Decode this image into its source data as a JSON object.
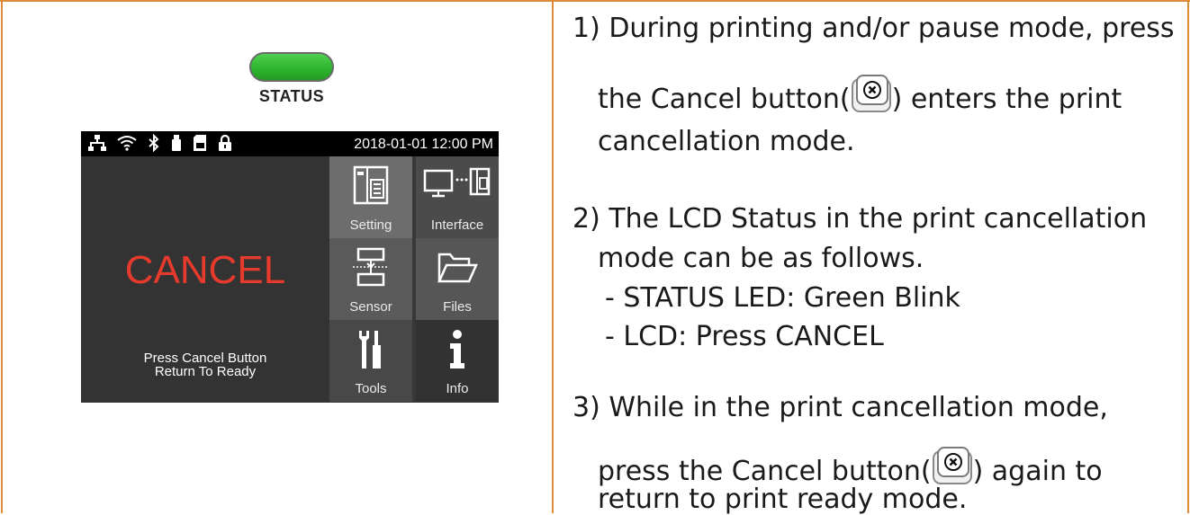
{
  "led": {
    "label": "STATUS",
    "color": "#3cc23c"
  },
  "lcd": {
    "status_icons": [
      "network-icon",
      "wifi-icon",
      "bluetooth-icon",
      "usb-icon",
      "sd-card-icon",
      "lock-icon"
    ],
    "datetime": "2018-01-01 12:00 PM",
    "main_text": "CANCEL",
    "main_text_color": "#e53a2c",
    "message_line1": "Press Cancel Button",
    "message_line2": "Return To Ready",
    "menu": [
      {
        "label": "Setting",
        "icon": "setting-icon"
      },
      {
        "label": "Interface",
        "icon": "interface-icon"
      },
      {
        "label": "Sensor",
        "icon": "sensor-icon"
      },
      {
        "label": "Files",
        "icon": "folder-icon"
      },
      {
        "label": "Tools",
        "icon": "tools-icon"
      },
      {
        "label": "Info",
        "icon": "info-icon"
      }
    ]
  },
  "instructions": {
    "step1_line1": "1) During printing and/or pause mode, press",
    "step1_line2a": "the Cancel button(",
    "step1_line2b": ") enters the print",
    "step1_line3": "cancellation mode.",
    "step2_line1": "2) The LCD Status in the print cancellation",
    "step2_line2": "mode can be as follows.",
    "step2_bullet1": "- STATUS LED: Green Blink",
    "step2_bullet2": "- LCD: Press CANCEL",
    "step3_line1": "3) While in the print cancellation mode,",
    "step3_line2a": "press the Cancel button(",
    "step3_line2b": ") again to",
    "step3_line3": "return to print ready mode."
  }
}
